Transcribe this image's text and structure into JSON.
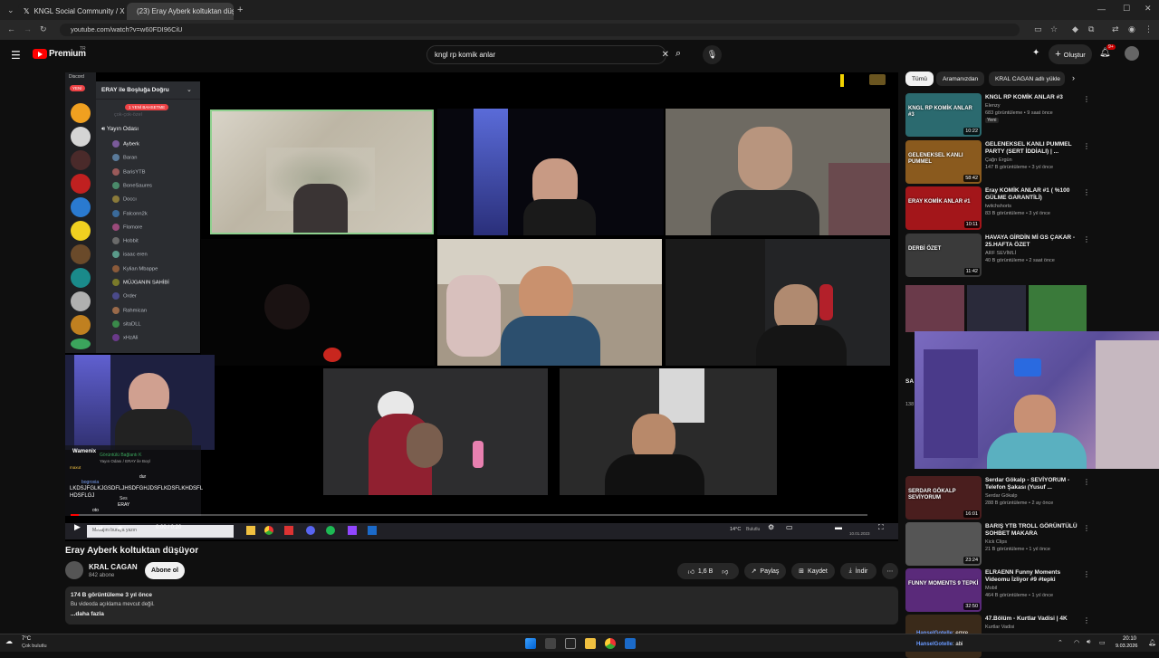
{
  "browser": {
    "tabs": [
      {
        "label": "KNGL Social Community / X"
      },
      {
        "label": "(23) Eray Ayberk koltuktan düşü"
      }
    ],
    "url": "youtube.com/watch?v=w60FDI96CiU"
  },
  "youtube": {
    "brand": "Premium",
    "brand_sup": "TR",
    "search_query": "kngl rp komik anlar",
    "create_label": "Oluştur",
    "notif_count": "9+"
  },
  "discord": {
    "server_label": "Discord",
    "new_badge": "YENİ",
    "server_name": "ERAY ile Boşluğa Doğru",
    "mention_badge": "1 YENİ BAHSETME",
    "faded_channel": "çok-çok-özel",
    "voice_channel": "Yayın Odası",
    "members": [
      "Ayberk",
      "Baran",
      "BarisYTB",
      "BoneSaures",
      "Doccı",
      "Falconn2k",
      "Flomore",
      "Hobbit",
      "isaac eren",
      "Kylian Mbappe",
      "MÜJGANIN SAHİBİ",
      "Order",
      "Rahmican",
      "sitaDLL",
      "xHzAli"
    ],
    "overlay_user": "Wamenix",
    "overlay_status": "Görüntülü Bağlantı K",
    "overlay_sub": "Yayın Odası / ERAY ile Boşl",
    "chat_text_1": "LKDSJFGLKJGSDFLJHSDFGHJDSFLKDSFLKHDSFL",
    "chat_text_2": "HDSFLGJ",
    "chat_user": "ERAY",
    "chat_label": "Ses",
    "chat_user2": "dur",
    "chat_user3": "bogroxia",
    "chat_user4": "maxut",
    "chat_user5": "oto",
    "chat_input": "Mesajını buraya yazın"
  },
  "video": {
    "time": "0:00 / 0:20",
    "taskbar_temp": "14°C",
    "taskbar_weather": "Bulutlu",
    "taskbar_date": "10.01.2023",
    "title": "Eray Ayberk koltuktan düşüyor",
    "channel": "KRAL CAGAN",
    "subscribers": "842 abone",
    "subscribe": "Abone ol",
    "likes": "1,6 B",
    "share": "Paylaş",
    "save": "Kaydet",
    "download": "İndir"
  },
  "description": {
    "stats": "174 B görüntüleme  3 yıl önce",
    "text": "Bu videoda açıklama mevcut değil.",
    "more": "...daha fazla"
  },
  "chips": [
    "Tümü",
    "Aramanızdan",
    "KRAL CAGAN adlı yükle"
  ],
  "recommendations": [
    {
      "title": "KNGL RP KOMİK ANLAR #3",
      "channel": "Elenzy",
      "meta": "683 görüntüleme • 9 saat önce",
      "badge": "Yeni",
      "duration": "10:22",
      "thumb_text": "KNGL RP KOMİK ANLAR #3",
      "color": "#2b6a6f"
    },
    {
      "title": "GELENEKSEL KANLI PUMMEL PARTY (SERT İDDİALI) | ...",
      "channel": "Çağrı Ergün",
      "meta": "147 B görüntüleme • 3 yıl önce",
      "duration": "58:42",
      "thumb_text": "GELENEKSEL KANLI PUMMEL",
      "color": "#8a5a1e"
    },
    {
      "title": "Eray KOMİK ANLAR #1 ( %100 GÜLME GARANTİLİ)",
      "channel": "twitchshorts",
      "meta": "83 B görüntüleme • 3 yıl önce",
      "duration": "10:11",
      "thumb_text": "ERAY KOMİK ANLAR #1",
      "color": "#a3161a"
    },
    {
      "title": "HAVAYA GİRDİN Mİ GS ÇAKAR - 25.HAFTA ÖZET",
      "channel": "ARF SEVİMLİ",
      "meta": "40 B görüntüleme • 2 saat önce",
      "duration": "11:42",
      "thumb_text": "DERBİ ÖZET",
      "color": "#3a3a3a"
    },
    {
      "title": "Serdar Gökalp - SEVİYORUM - Telefon Şakası (Yusuf ...",
      "channel": "Serdar Gökalp",
      "meta": "288 B görüntüleme • 2 ay önce",
      "duration": "16:01",
      "thumb_text": "SERDAR GÖKALP SEVİYORUM",
      "color": "#4a1e1e"
    },
    {
      "title": "BARIŞ YTB TROLL GÖRÜNTÜLÜ SOHBET MAKARA",
      "channel": "Kick Clips",
      "meta": "21 B görüntüleme • 1 yıl önce",
      "duration": "23:24",
      "thumb_text": "",
      "color": "#555"
    },
    {
      "title": "ELRAENN Funny Moments Videomu İzliyor #9 #tepki",
      "channel": "Mobil",
      "meta": "464 B görüntüleme • 1 yıl önce",
      "duration": "32:50",
      "thumb_text": "FUNNY MOMENTS 9 TEPKİ",
      "color": "#5a2a7a"
    },
    {
      "title": "47.Bölüm - Kurtlar Vadisi | 4K",
      "channel": "Kurtlar Vadisi",
      "meta": "",
      "duration": "",
      "thumb_text": "",
      "color": "#3a2a1a"
    }
  ],
  "hidden_rec": {
    "title": "SA KIS",
    "meta": "138"
  },
  "overlay_chat": [
    {
      "user": "HanselGotelle",
      "msg": "emre"
    },
    {
      "user": "HanselGotelle",
      "msg": "abi"
    }
  ],
  "taskbar": {
    "weather_temp": "7°C",
    "weather_text": "Çok bulutlu",
    "time": "20:10",
    "date": "9.03.2026"
  }
}
